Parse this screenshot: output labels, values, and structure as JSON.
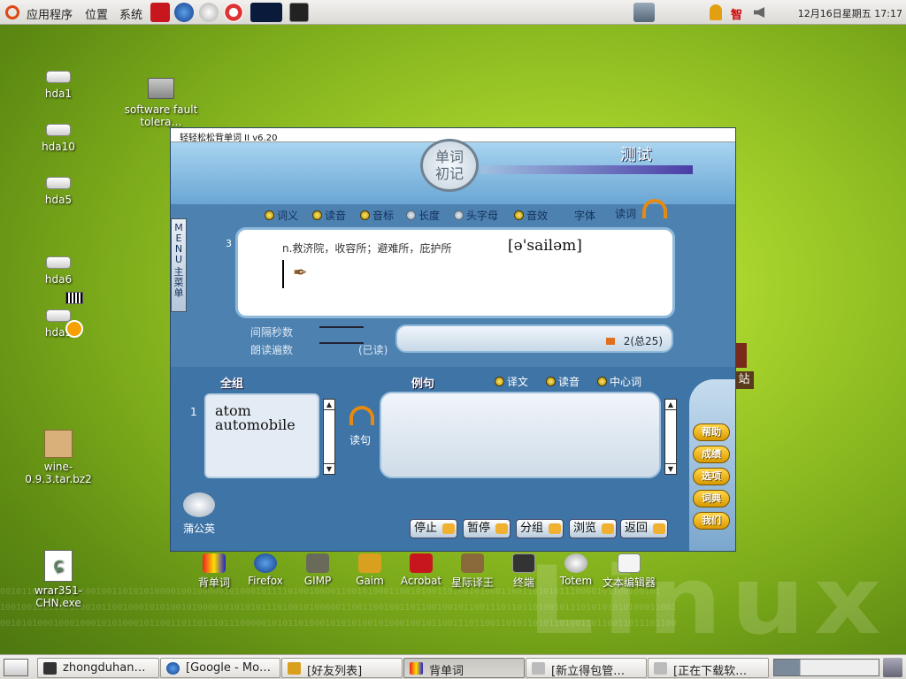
{
  "top_panel": {
    "menus": [
      "应用程序",
      "位置",
      "系统"
    ],
    "clock": "12月16日星期五 17:17",
    "ime_label": "智"
  },
  "desktop": {
    "icons": [
      {
        "label": "hda1",
        "kind": "drive"
      },
      {
        "label": "hda10",
        "kind": "drive"
      },
      {
        "label": "hda5",
        "kind": "drive"
      },
      {
        "label": "hda6",
        "kind": "drive"
      },
      {
        "label": "hda9",
        "kind": "drive"
      },
      {
        "label": "software fault tolera…",
        "kind": "folder"
      },
      {
        "label": "wine-0.9.3.tar.bz2",
        "kind": "archive"
      },
      {
        "label": "wrar351-CHN.exe",
        "kind": "exe"
      }
    ],
    "partial_label": "站",
    "watermark": "Linux",
    "bits_line_1": "0010110010000001001001101010100001001000001010001011110100100001100101000110010100110100101000110011010101110000101100100101",
    "bits_line_2": "1001001001100100010110010001010100101000010101010111010010100000110011001001101100100101100111011011010010111010101010100011001",
    "bits_line_3": "0010101000100010001010100010110011011011101110000010101101000101010100101000100101100111011001101011010110100110110011011101100"
  },
  "app": {
    "title": "轻轻松松背单词 II  v6.20",
    "badge_line1": "单词",
    "badge_line2": "初记",
    "mode": "测试",
    "options": [
      {
        "label": "词义",
        "on": true
      },
      {
        "label": "读音",
        "on": true
      },
      {
        "label": "音标",
        "on": true
      },
      {
        "label": "长度",
        "on": false
      },
      {
        "label": "头字母",
        "on": false
      },
      {
        "label": "音效",
        "on": true
      }
    ],
    "font_label": "字体",
    "read_word_label": "读词",
    "word_index": "3",
    "meaning": "n.救济院，收容所；避难所，庇护所",
    "phonetic": "[ə'sailəm]",
    "interval_label": "间隔秒数",
    "read_count_label": "朗读遍数",
    "read_status": "(已读)",
    "count_read": "2",
    "count_total_label": "(总",
    "count_total": "25)",
    "tab_group": "全组",
    "tab_example": "例句",
    "example_options": [
      {
        "label": "译文",
        "on": true
      },
      {
        "label": "读音",
        "on": true
      },
      {
        "label": "中心词",
        "on": true
      }
    ],
    "list_index": "1",
    "word_list": [
      "atom",
      "automobile"
    ],
    "read_sentence_label": "读句",
    "side_buttons": [
      "帮助",
      "成绩",
      "选项",
      "词典",
      "我们"
    ],
    "bottom_buttons": [
      "停止",
      "暂停",
      "分组",
      "浏览",
      "返回"
    ],
    "publisher": "蒲公英",
    "menu_label": "MENU",
    "menu_label_cn": "主菜单"
  },
  "launchers": [
    "背单词",
    "Firefox",
    "GIMP",
    "Gaim",
    "Acrobat",
    "星际译王",
    "终端",
    "Totem",
    "文本编辑器"
  ],
  "taskbar": {
    "tasks": [
      {
        "label": "zhongduhan…"
      },
      {
        "label": "[Google - Mo…"
      },
      {
        "label": "[好友列表]"
      },
      {
        "label": "背单词",
        "active": true
      },
      {
        "label": "[新立得包管…"
      },
      {
        "label": "[正在下载软…"
      }
    ]
  }
}
